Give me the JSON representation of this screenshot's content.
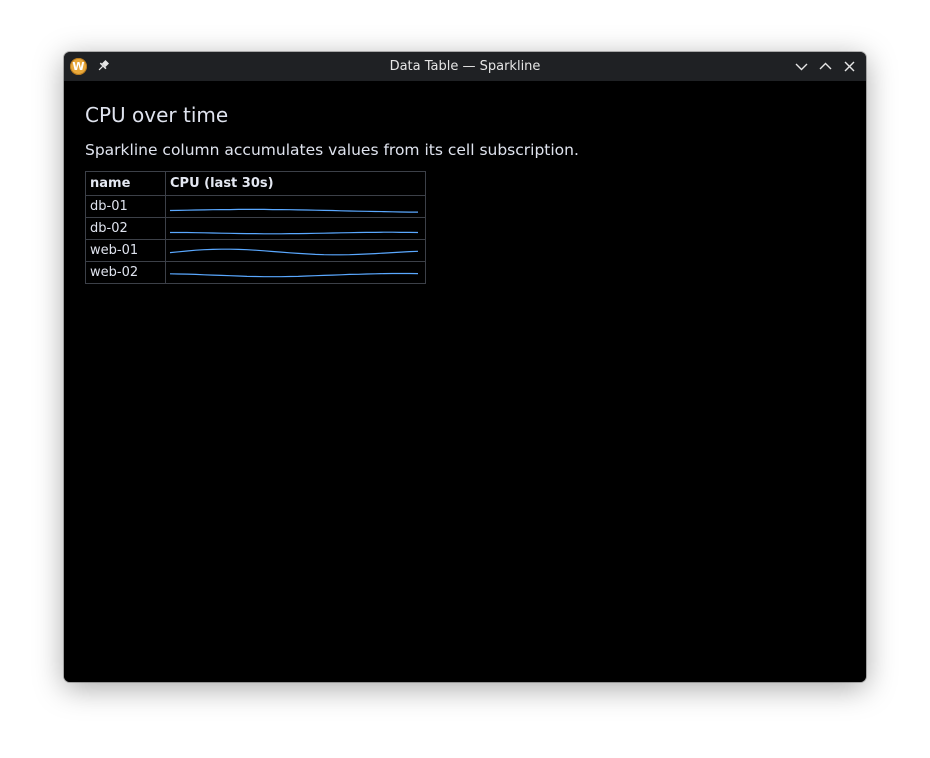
{
  "window": {
    "title": "Data Table — Sparkline",
    "app_icon_letter": "W"
  },
  "main": {
    "heading": "CPU over time",
    "subtitle": "Sparkline column accumulates values from its cell subscription."
  },
  "table": {
    "columns": [
      "name",
      "CPU (last 30s)"
    ],
    "rows": [
      {
        "name": "db-01",
        "series": [
          28,
          29,
          30,
          31,
          32,
          33,
          34,
          34,
          35,
          35,
          35,
          35,
          34,
          34,
          33,
          32,
          31,
          30,
          29,
          28,
          26,
          25,
          24,
          23,
          22,
          21,
          20,
          19,
          18,
          18
        ]
      },
      {
        "name": "db-02",
        "series": [
          28,
          28,
          28,
          27,
          26,
          25,
          24,
          23,
          22,
          21,
          21,
          20,
          20,
          20,
          21,
          21,
          22,
          23,
          24,
          25,
          26,
          27,
          28,
          29,
          29,
          30,
          30,
          29,
          29,
          28
        ]
      },
      {
        "name": "web-01",
        "series": [
          40,
          45,
          50,
          55,
          58,
          60,
          61,
          61,
          60,
          58,
          55,
          51,
          47,
          43,
          39,
          35,
          32,
          29,
          27,
          26,
          26,
          27,
          29,
          31,
          34,
          37,
          40,
          43,
          46,
          48
        ]
      },
      {
        "name": "web-02",
        "series": [
          45,
          44,
          43,
          41,
          39,
          37,
          35,
          33,
          31,
          29,
          28,
          27,
          27,
          27,
          28,
          29,
          31,
          33,
          35,
          37,
          39,
          41,
          42,
          44,
          45,
          46,
          47,
          47,
          47,
          46
        ]
      }
    ],
    "spark_color": "#5aa8ff",
    "y_range": [
      0,
      100
    ]
  },
  "colors": {
    "titlebar": "#1f2124",
    "background": "#000000",
    "text": "#dfe3ee",
    "border": "#3c4048"
  }
}
